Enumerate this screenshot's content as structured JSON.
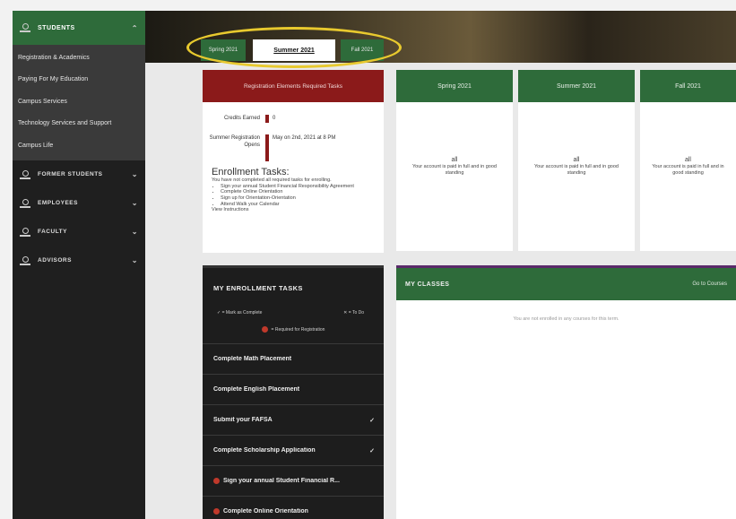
{
  "sidebar": {
    "active_section": "STUDENTS",
    "student_links": [
      "Registration & Academics",
      "Paying For My Education",
      "Campus Services",
      "Technology Services and Support",
      "Campus Life"
    ],
    "sections": [
      "FORMER STUDENTS",
      "EMPLOYEES",
      "FACULTY",
      "ADVISORS"
    ]
  },
  "term_tabs": {
    "spring": "Spring 2021",
    "summer": "Summer 2021",
    "fall": "Fall 2021"
  },
  "registration": {
    "header": "Registration Elements Required Tasks",
    "credits_label": "Credits Earned",
    "credits_value": "0",
    "opens_label": "Summer Registration Opens",
    "opens_value": "May on 2nd, 2021 at 8 PM",
    "enrollment_title": "Enrollment Tasks:",
    "enrollment_text": "You have not completed all required tasks for enrolling.",
    "enrollment_items": [
      "Sign your annual Student Financial Responsibility Agreement",
      "Complete Online Orientation",
      "Sign up for Orientation-Orientation",
      "Attend Walk your Calendar"
    ],
    "enrollment_footer": "View Instructions"
  },
  "term_cards": [
    {
      "title": "Spring 2021",
      "value": "all",
      "message": "Your account is paid in full and in good standing"
    },
    {
      "title": "Summer 2021",
      "value": "all",
      "message": "Your account is paid in full and in good standing"
    },
    {
      "title": "Fall 2021",
      "value": "all",
      "message": "Your account is paid in full and in good standing"
    }
  ],
  "tasks": {
    "title": "MY ENROLLMENT TASKS",
    "legend_done": "✓ = Mark as Complete",
    "legend_todo": "✕ = To Do",
    "legend_required": "= Required for Registration",
    "items": [
      {
        "label": "Complete Math Placement",
        "mark": "",
        "required": false
      },
      {
        "label": "Complete English Placement",
        "mark": "",
        "required": false
      },
      {
        "label": "Submit your FAFSA",
        "mark": "✓",
        "required": false
      },
      {
        "label": "Complete Scholarship Application",
        "mark": "✓",
        "required": false
      },
      {
        "label": "Sign your annual Student Financial R...",
        "mark": "",
        "required": true
      },
      {
        "label": "Complete Online Orientation",
        "mark": "",
        "required": true
      }
    ]
  },
  "classes": {
    "title": "MY CLASSES",
    "link": "Go to Courses",
    "message": "You are not enrolled in any courses for this term."
  }
}
